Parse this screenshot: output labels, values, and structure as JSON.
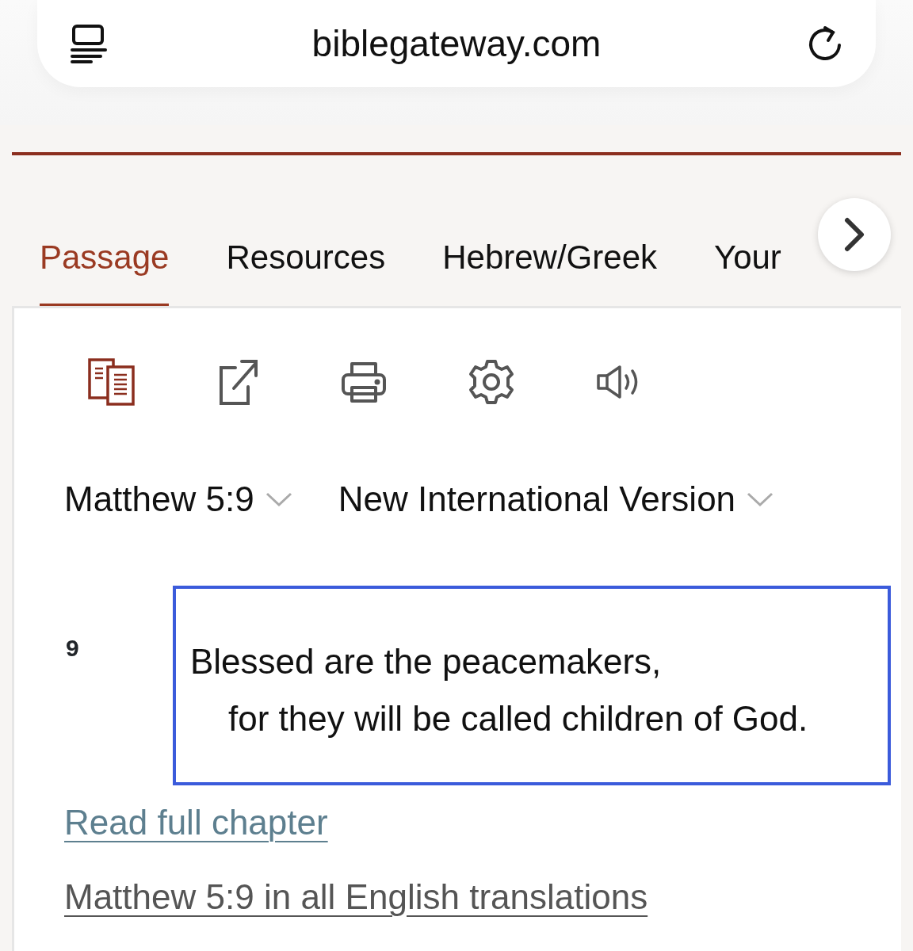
{
  "address_bar": {
    "url": "biblegateway.com"
  },
  "tabs": [
    {
      "label": "Passage",
      "selected": true
    },
    {
      "label": "Resources",
      "selected": false
    },
    {
      "label": "Hebrew/Greek",
      "selected": false
    },
    {
      "label": "Your",
      "selected": false
    }
  ],
  "toolbar": [
    {
      "kind": "parallel",
      "selected": true
    },
    {
      "kind": "share",
      "selected": false
    },
    {
      "kind": "print",
      "selected": false
    },
    {
      "kind": "settings",
      "selected": false
    },
    {
      "kind": "audio",
      "selected": false
    }
  ],
  "selectors": [
    {
      "label": "Matthew 5:9"
    },
    {
      "label": "New International Version"
    }
  ],
  "verse": {
    "number": "9",
    "lines": [
      "Blessed are the peacemakers,",
      "for they will be called children of God."
    ],
    "highlighted": true
  },
  "links": [
    {
      "label": "Read full chapter",
      "kind": "primary"
    },
    {
      "label": "Matthew 5:9 in all English translations",
      "kind": "secondary"
    }
  ]
}
